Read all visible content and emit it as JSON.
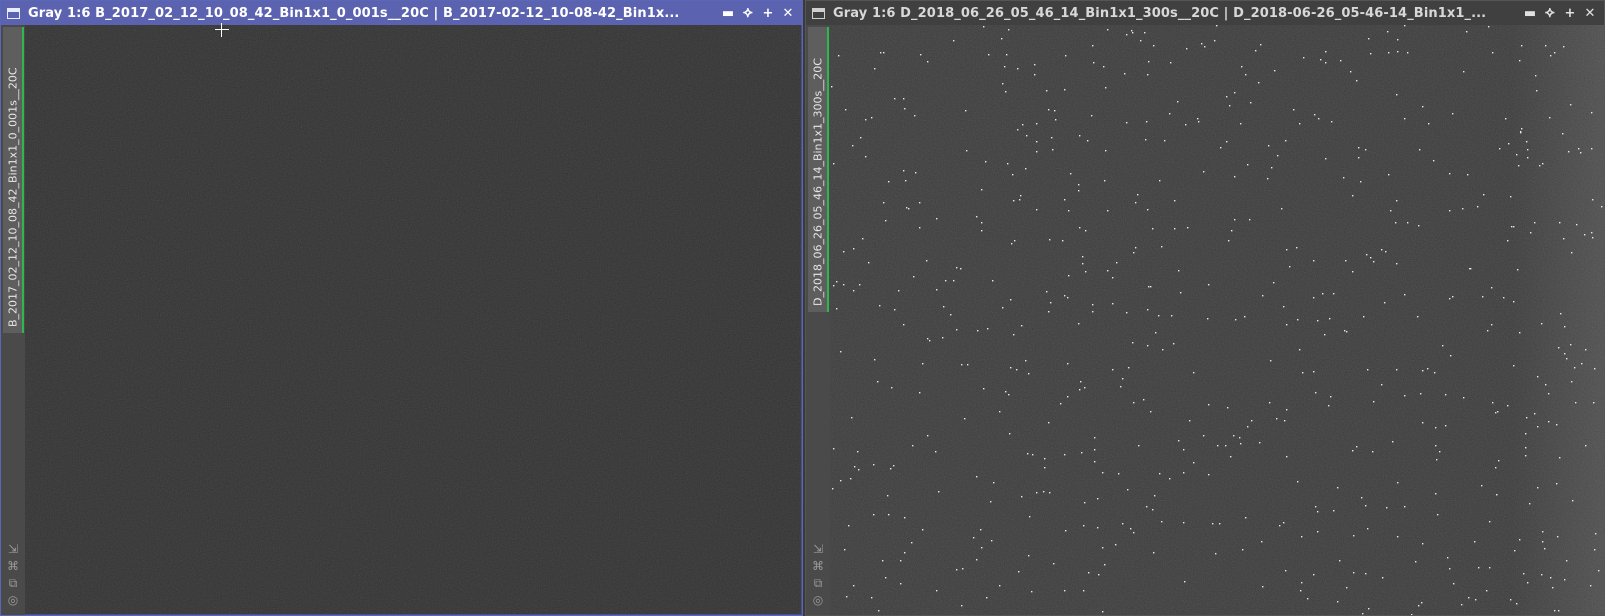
{
  "windows": [
    {
      "title": "Gray 1:6 B_2017_02_12_10_08_42_Bin1x1_0_001s__20C | B_2017-02-12_10-08-42_Bin1x...",
      "tab_label": "B_2017_02_12_10_08_42_Bin1x1_0_001s__20C",
      "controls": {
        "minimize": "▬",
        "shade": "⯎",
        "maximize": "+",
        "close": "✕"
      },
      "side_icons": [
        "resize-icon",
        "fit-icon",
        "clone-icon",
        "target-icon"
      ],
      "active": true
    },
    {
      "title": "Gray 1:6 D_2018_06_26_05_46_14_Bin1x1_300s__20C | D_2018-06-26_05-46-14_Bin1x1_...",
      "tab_label": "D_2018_06_26_05_46_14_Bin1x1_300s__20C",
      "controls": {
        "minimize": "▬",
        "shade": "⯎",
        "maximize": "+",
        "close": "✕"
      },
      "side_icons": [
        "resize-icon",
        "fit-icon",
        "clone-icon",
        "target-icon"
      ],
      "active": false
    }
  ],
  "colors": {
    "active_titlebar": "#5b63b0",
    "inactive_titlebar": "#404040",
    "tab_accent": "#2fb84a"
  }
}
